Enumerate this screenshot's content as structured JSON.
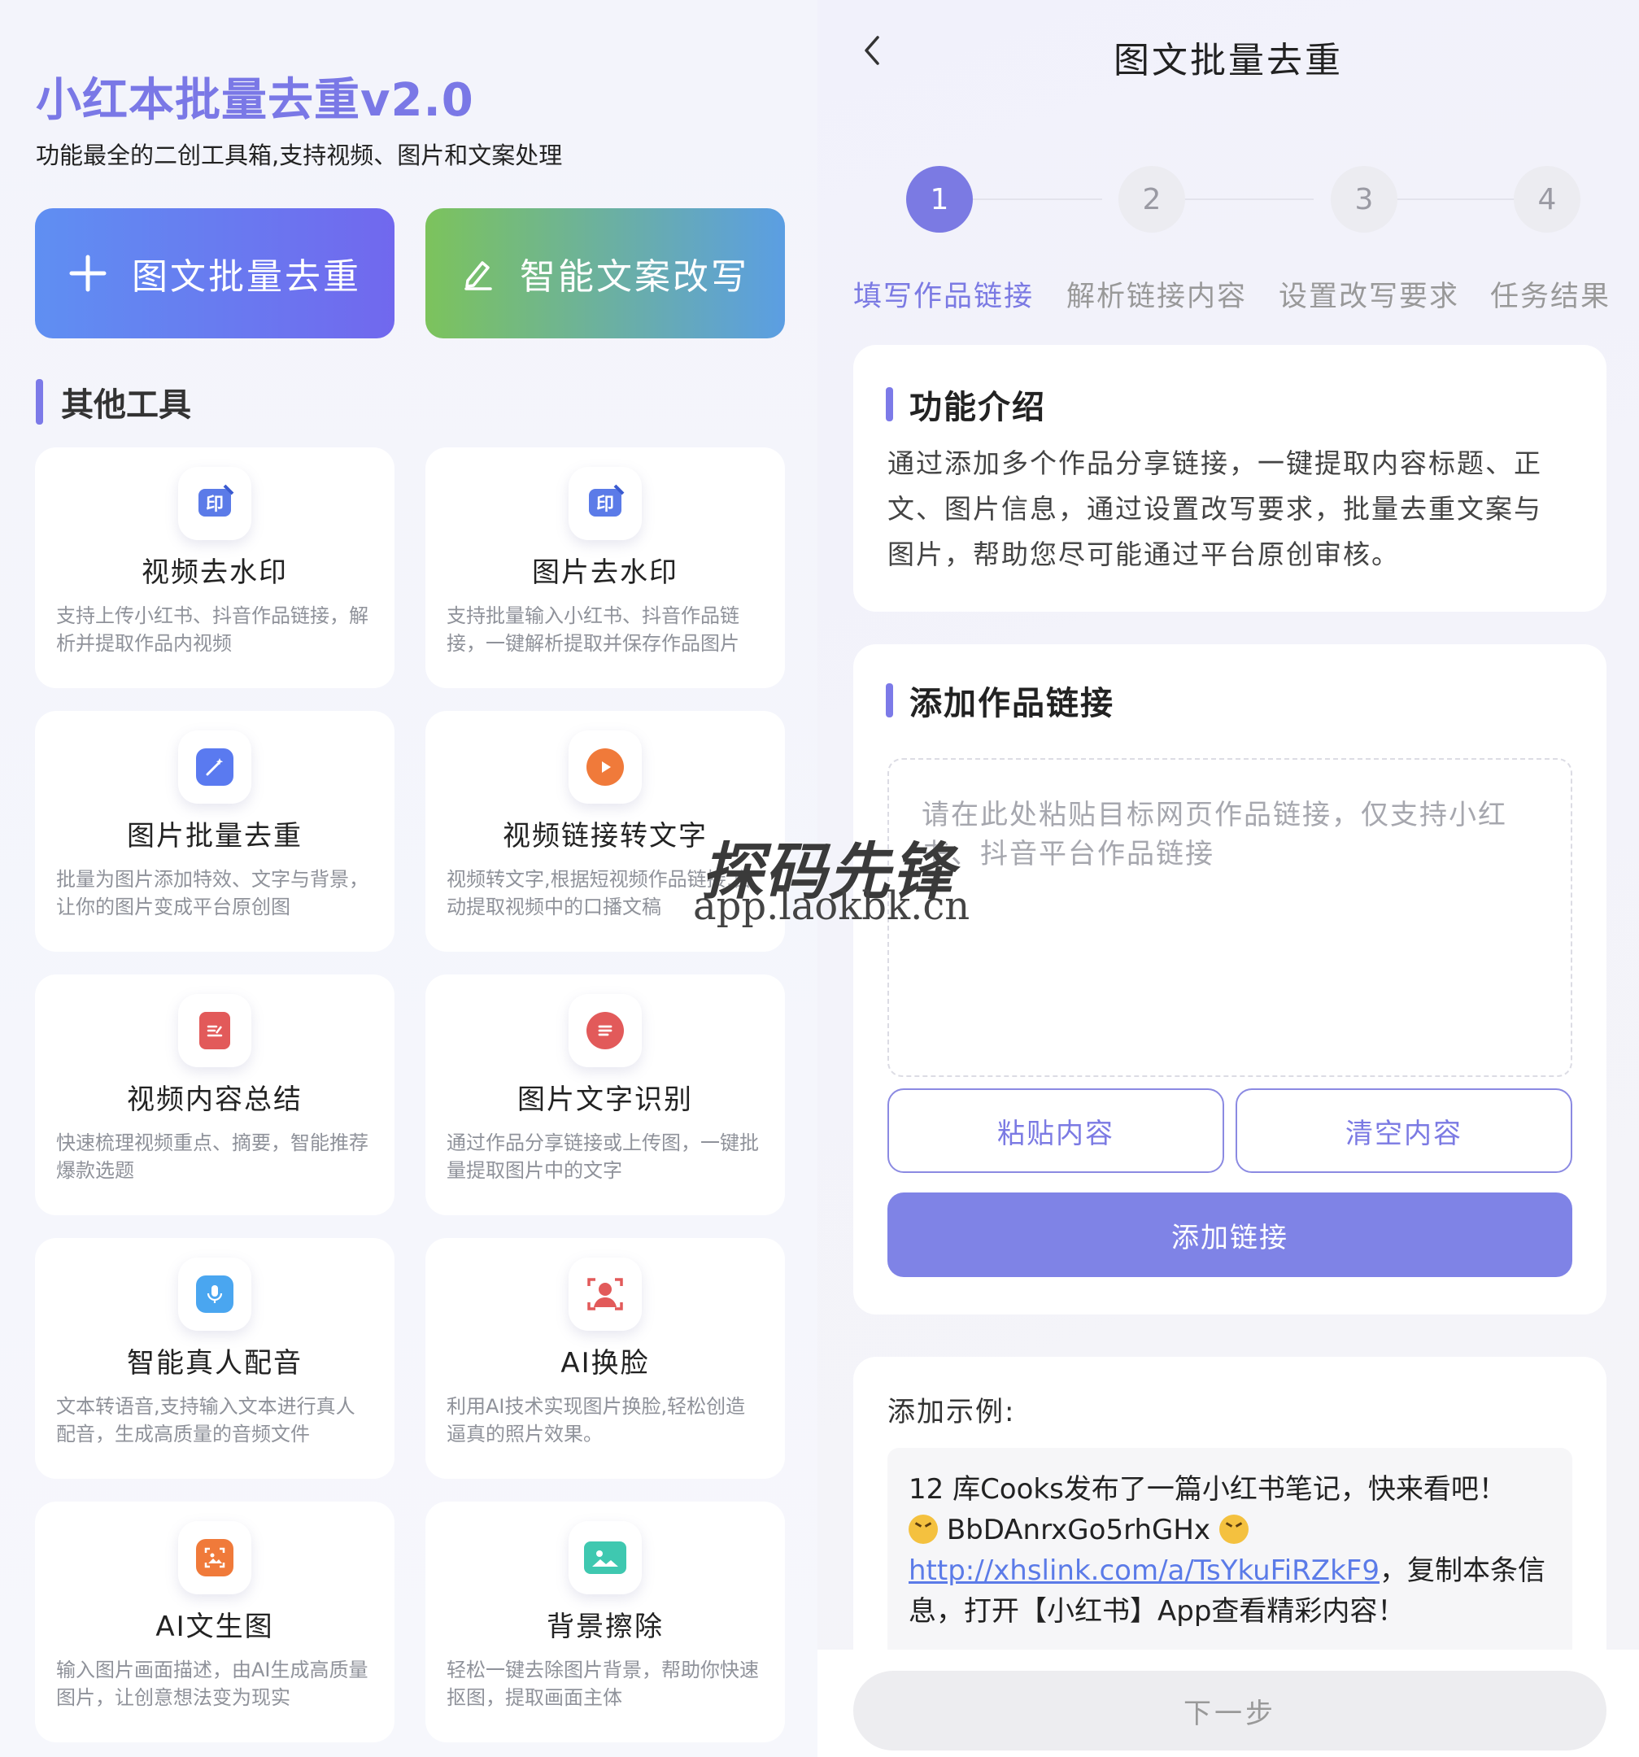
{
  "left": {
    "title": "小红本批量去重v2.0",
    "subtitle": "功能最全的二创工具箱,支持视频、图片和文案处理",
    "hero_buttons": [
      {
        "label": "图文批量去重",
        "icon": "plus-icon"
      },
      {
        "label": "智能文案改写",
        "icon": "pen-icon"
      }
    ],
    "section_title": "其他工具",
    "tools": [
      {
        "title": "视频去水印",
        "desc": "支持上传小红书、抖音作品链接，解析并提取作品内视频",
        "icon": "watermark-stamp-icon",
        "color": "#5b7be8"
      },
      {
        "title": "图片去水印",
        "desc": "支持批量输入小红书、抖音作品链接，一键解析提取并保存作品图片",
        "icon": "watermark-stamp-icon",
        "color": "#5b7be8"
      },
      {
        "title": "图片批量去重",
        "desc": "批量为图片添加特效、文字与背景，让你的图片变成平台原创图",
        "icon": "magic-wand-icon",
        "color": "#5a7af0"
      },
      {
        "title": "视频链接转文字",
        "desc": "视频转文字,根据短视频作品链接,自动提取视频中的口播文稿",
        "icon": "play-icon",
        "color": "#f07a3a"
      },
      {
        "title": "视频内容总结",
        "desc": "快速梳理视频重点、摘要，智能推荐爆款选题",
        "icon": "document-edit-icon",
        "color": "#e25a5a"
      },
      {
        "title": "图片文字识别",
        "desc": "通过作品分享链接或上传图，一键批量提取图片中的文字",
        "icon": "text-lines-icon",
        "color": "#e25a5a"
      },
      {
        "title": "智能真人配音",
        "desc": "文本转语音,支持输入文本进行真人配音，生成高质量的音频文件",
        "icon": "microphone-icon",
        "color": "#4aa6f0"
      },
      {
        "title": "AI换脸",
        "desc": "利用AI技术实现图片换脸,轻松创造逼真的照片效果。",
        "icon": "face-scan-icon",
        "color": "#e25a5a"
      },
      {
        "title": "AI文生图",
        "desc": "输入图片画面描述，由AI生成高质量图片，让创意想法变为现实",
        "icon": "image-frame-icon",
        "color": "#f07a3a"
      },
      {
        "title": "背景擦除",
        "desc": "轻松一键去除图片背景，帮助你快速抠图，提取画面主体",
        "icon": "landscape-icon",
        "color": "#3fc8b0"
      }
    ]
  },
  "right": {
    "page_title": "图文批量去重",
    "steps": [
      {
        "num": "1",
        "label": "填写作品链接",
        "active": true
      },
      {
        "num": "2",
        "label": "解析链接内容",
        "active": false
      },
      {
        "num": "3",
        "label": "设置改写要求",
        "active": false
      },
      {
        "num": "4",
        "label": "任务结果",
        "active": false
      }
    ],
    "intro": {
      "title": "功能介绍",
      "text": "通过添加多个作品分享链接，一键提取内容标题、正文、图片信息，通过设置改写要求，批量去重文案与图片，帮助您尽可能通过平台原创审核。"
    },
    "add_link": {
      "title": "添加作品链接",
      "placeholder": "请在此处粘贴目标网页作品链接，仅支持小红书、抖音平台作品链接",
      "paste_label": "粘贴内容",
      "clear_label": "清空内容",
      "add_label": "添加链接"
    },
    "example": {
      "title": "添加示例:",
      "line1": "12 库Cooks发布了一篇小红书笔记，快来看吧！",
      "code": "BbDAnrxGo5rhGHx",
      "link": "http://xhslink.com/a/TsYkuFiRZkF9",
      "tail": "，复制本条信息，打开【小红书】App查看精彩内容！"
    },
    "next_label": "下一步"
  },
  "watermark": {
    "name": "探码先锋",
    "url": "app.laokbk.cn"
  },
  "colors": {
    "accent": "#7b7ae3",
    "title": "#7a78e6"
  }
}
